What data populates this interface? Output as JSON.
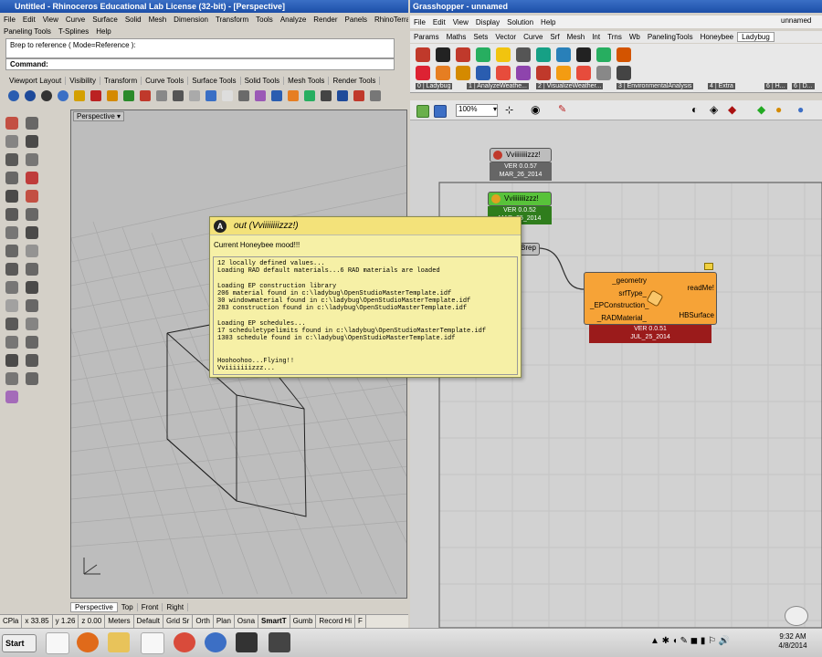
{
  "rhino": {
    "title": "Untitled - Rhinoceros Educational Lab License (32-bit) - [Perspective]",
    "menu": [
      "File",
      "Edit",
      "View",
      "Curve",
      "Surface",
      "Solid",
      "Mesh",
      "Dimension",
      "Transform",
      "Tools",
      "Analyze",
      "Render",
      "Panels",
      "RhinoTerrain"
    ],
    "menu2": [
      "Paneling Tools",
      "T-Splines",
      "Help"
    ],
    "history_line": "Brep to reference ( Mode=Reference ):",
    "command_label": "Command:",
    "toolbar_tabs": [
      "Viewport Layout",
      "Visibility",
      "Transform",
      "Curve Tools",
      "Surface Tools",
      "Solid Tools",
      "Mesh Tools",
      "Render Tools"
    ],
    "viewport_label": "Perspective",
    "view_tabs": [
      "Perspective",
      "Top",
      "Front",
      "Right"
    ],
    "status": [
      "CPla",
      "x 33.85",
      "y 1.26",
      "z 0.00",
      "Meters",
      "Default",
      "Grid Sr",
      "Orth",
      "Plan",
      "Osna",
      "SmartT",
      "Gumb",
      "Record Hi",
      "F"
    ]
  },
  "grasshopper": {
    "title": "Grasshopper - unnamed",
    "doc_name": "unnamed",
    "menu": [
      "File",
      "Edit",
      "View",
      "Display",
      "Solution",
      "Help"
    ],
    "tabs": [
      "Params",
      "Maths",
      "Sets",
      "Vector",
      "Curve",
      "Srf",
      "Mesh",
      "Int",
      "Trns",
      "Wb",
      "PanelingTools",
      "Honeybee",
      "Ladybug"
    ],
    "groups": [
      "0 | Ladybug",
      "1 | AnalyzeWeathe...",
      "2 | VisualizeWeather...",
      "3 | EnvironmentalAnalysis",
      "4 | Extra",
      "6 | H...",
      "6 | D..."
    ],
    "zoom": "100%",
    "node1": {
      "label": "Vviiiiiiiizzz!",
      "ver": "VER 0.0.57",
      "date": "MAR_26_2014"
    },
    "node2": {
      "label": "Vviiiiiiiizzz!",
      "ver": "VER 0.0.52",
      "date": "MAR_25_2014"
    },
    "brep_label": "Brep",
    "bignode": {
      "inputs": [
        "_geometry",
        "srfType_",
        "_EPConstruction_",
        "_RADMaterial_"
      ],
      "outputs": [
        "readMe!",
        "HBSurface"
      ],
      "ver": "VER 0.0.51",
      "date": "JUL_25_2014"
    }
  },
  "panel": {
    "title": "out (Vviiiiiiiizzz!)",
    "subtitle": "Current Honeybee mood!!!",
    "lines": [
      "12 locally defined values...",
      "Loading RAD default materials...6 RAD materials are loaded",
      "",
      "Loading EP construction library",
      "206 material found in c:\\ladybug\\OpenStudioMasterTemplate.idf",
      "30 windowmaterial found in c:\\ladybug\\OpenStudioMasterTemplate.idf",
      "283 construction found in c:\\ladybug\\OpenStudioMasterTemplate.idf",
      "",
      "Loading EP schedules...",
      "17 scheduletypelimits found in c:\\ladybug\\OpenStudioMasterTemplate.idf",
      "1303 schedule found in c:\\ladybug\\OpenStudioMasterTemplate.idf",
      "",
      "",
      "Hoohoohoo...Flying!!",
      "Vviiiiiiizzz..."
    ]
  },
  "taskbar": {
    "start": "Start",
    "time": "9:32 AM",
    "date": "4/8/2014"
  },
  "colors": {
    "gh_canvas": "#d2d2d2",
    "node_orange": "#f6a337",
    "node_green": "#58c23a",
    "panel_bg": "#f6f0a6",
    "footer_red": "#9b1b1b"
  }
}
